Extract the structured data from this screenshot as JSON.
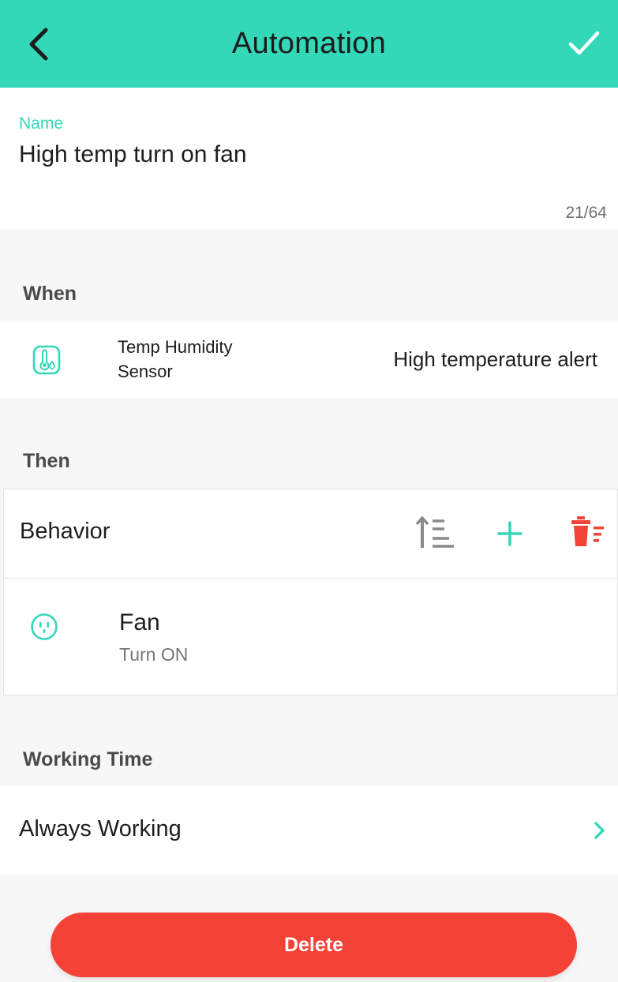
{
  "header": {
    "title": "Automation",
    "back_icon": "chevron-left-icon",
    "confirm_icon": "checkmark-icon",
    "color": "#33d8b9"
  },
  "name": {
    "label": "Name",
    "value": "High temp turn on fan",
    "counter": "21/64"
  },
  "when": {
    "label": "When",
    "condition": {
      "icon": "thermometer-icon",
      "device": "Temp Humidity Sensor",
      "trigger": "High temperature alert"
    }
  },
  "then": {
    "label": "Then",
    "behavior_label": "Behavior",
    "tools": {
      "sort_icon": "sort-ascending-icon",
      "add_icon": "plus-icon",
      "delete_icon": "trash-icon"
    },
    "actions": [
      {
        "icon": "outlet-icon",
        "name": "Fan",
        "state": "Turn ON"
      }
    ]
  },
  "working_time": {
    "label": "Working Time",
    "value": "Always Working",
    "chevron_icon": "chevron-right-icon"
  },
  "delete_button": {
    "label": "Delete",
    "color": "#f44336"
  },
  "colors": {
    "accent": "#33d8b9",
    "danger": "#f44336",
    "background": "#f7f7f7"
  }
}
